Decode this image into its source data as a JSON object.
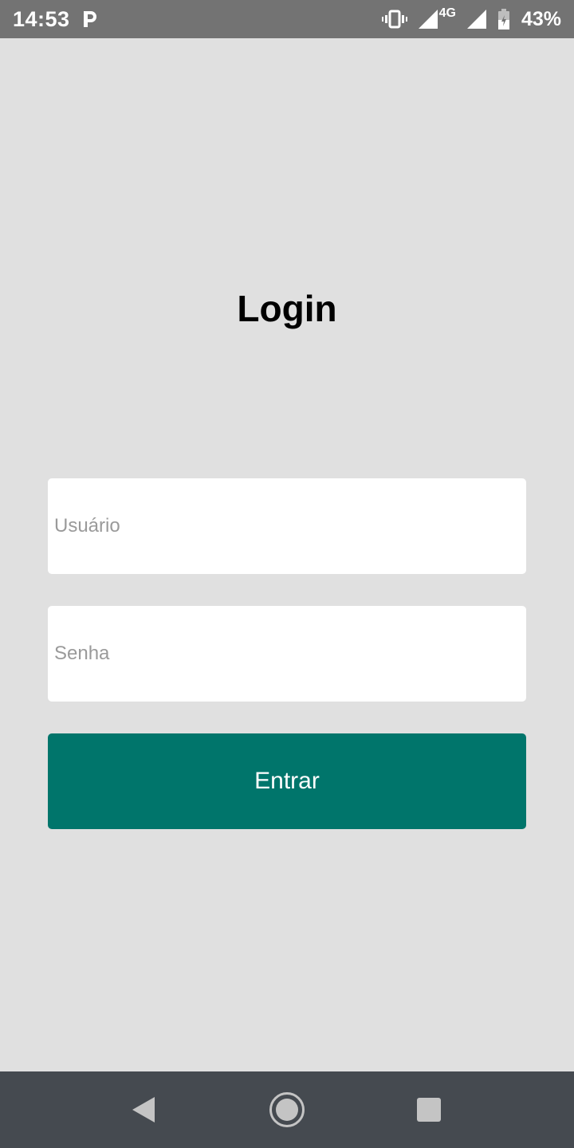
{
  "status_bar": {
    "time": "14:53",
    "network": "4G",
    "battery_percent": "43%",
    "icons": [
      "p-app-icon",
      "vibrate-icon",
      "signal-icon",
      "signal-4g-icon",
      "battery-icon"
    ]
  },
  "page": {
    "title": "Login"
  },
  "form": {
    "username_placeholder": "Usuário",
    "password_placeholder": "Senha",
    "submit_label": "Entrar"
  },
  "colors": {
    "background": "#e0e0e0",
    "status_bar": "#737373",
    "accent": "#00756b",
    "nav_bar": "#454a50"
  },
  "nav_bar": {
    "icons": [
      "back-icon",
      "home-icon",
      "recents-icon"
    ]
  }
}
